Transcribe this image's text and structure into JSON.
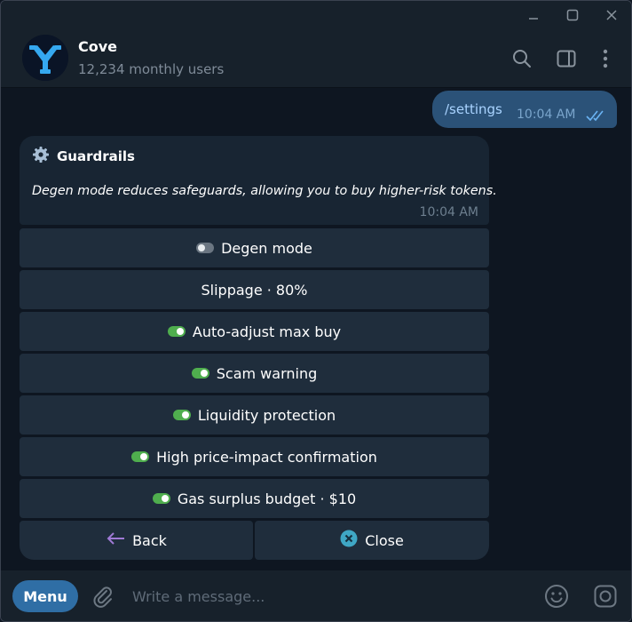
{
  "window": {
    "controls": [
      "minimize-icon",
      "maximize-icon",
      "close-icon"
    ]
  },
  "header": {
    "title": "Cove",
    "subtitle": "12,234 monthly users",
    "icons": [
      "search-icon",
      "sidebar-toggle-icon",
      "more-vertical-icon"
    ]
  },
  "outgoing": {
    "text": "/settings",
    "time": "10:04 AM",
    "status_icon": "double-check-icon"
  },
  "incoming": {
    "title": "Guardrails",
    "title_icon": "gear-icon",
    "body": "Degen mode reduces safeguards, allowing you to buy higher-risk tokens.",
    "time": "10:04 AM"
  },
  "keyboard": {
    "buttons": [
      {
        "label": "Degen mode",
        "toggle": "off"
      },
      {
        "label": "Slippage · 80%",
        "toggle": null
      },
      {
        "label": "Auto-adjust max buy",
        "toggle": "on"
      },
      {
        "label": "Scam warning",
        "toggle": "on"
      },
      {
        "label": "Liquidity protection",
        "toggle": "on"
      },
      {
        "label": "High price-impact confirmation",
        "toggle": "on"
      },
      {
        "label": "Gas surplus budget · $10",
        "toggle": "on"
      }
    ],
    "back_label": "Back",
    "close_label": "Close"
  },
  "input": {
    "menu_label": "Menu",
    "placeholder": "Write a message..."
  },
  "colors": {
    "background": "#0e1621",
    "panel": "#17212b",
    "outgoing_bubble": "#2b5278",
    "incoming_bubble": "#182533",
    "keyboard_button": "#1f2d3c",
    "toggle_on": "#4fae4e",
    "accent": "#2f6ea5"
  }
}
